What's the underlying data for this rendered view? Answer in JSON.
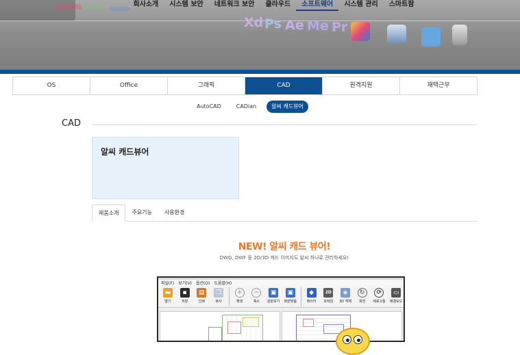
{
  "top_nav": [
    "회사소개",
    "시스템 보안",
    "네트워크 보안",
    "클라우드",
    "소프트웨어",
    "시스템 관리",
    "스마트팜"
  ],
  "top_nav_active": "소프트웨어",
  "hero_apps": [
    "Xd",
    "Ps",
    "Ae",
    "Me",
    "Pr"
  ],
  "category_tabs": [
    "OS",
    "Office",
    "그래픽",
    "CAD",
    "원격지원",
    "재택근무"
  ],
  "category_active": "CAD",
  "sub_tabs": [
    "AutoCAD",
    "CADian",
    "알씨 캐드뷰어"
  ],
  "sub_active": "알씨 캐드뷰어",
  "section_title": "CAD",
  "product_name": "알씨 캐드뷰어",
  "detail_tabs": [
    "제품소개",
    "주요기능",
    "사용환경"
  ],
  "detail_active": "제품소개",
  "promo": {
    "headline": "NEW! 알씨 캐드 뷰어!",
    "subtitle": "DWG, DWF 등 2D/3D 캐드 이미지도 알씨 하나로 관리하세요!"
  },
  "viewer": {
    "menu": [
      "파일(F)",
      "보기(V)",
      "옵션(O)",
      "도움말(H)"
    ],
    "tools": [
      {
        "label": "열기",
        "icon": "folder-icon",
        "color": "#e8a22a"
      },
      {
        "label": "저장",
        "icon": "save-icon",
        "color": "#2c2c2c"
      },
      {
        "label": "인쇄",
        "icon": "print-icon",
        "color": "#d07a2a"
      },
      {
        "label": "복사",
        "icon": "copy-icon",
        "color": "#b8c6d6"
      },
      {
        "label": "확대",
        "icon": "zoom-in-icon",
        "color": "#9a9a9a"
      },
      {
        "label": "축소",
        "icon": "zoom-out-icon",
        "color": "#9a9a9a"
      },
      {
        "label": "원본보기",
        "icon": "original-view-icon",
        "color": "#3a6fc0"
      },
      {
        "label": "화면맞춤",
        "icon": "fit-screen-icon",
        "color": "#3a6fc0"
      },
      {
        "label": "레이어",
        "icon": "layer-icon",
        "color": "#2f63b8"
      },
      {
        "label": "프레임",
        "icon": "frame-2d-icon",
        "color": "#5a5a5a"
      },
      {
        "label": "3D 객체",
        "icon": "3d-object-icon",
        "color": "#7b9ccf"
      },
      {
        "label": "회전",
        "icon": "rotate-icon",
        "color": "#666666"
      },
      {
        "label": "새로고침",
        "icon": "refresh-icon",
        "color": "#444444"
      },
      {
        "label": "배경모드",
        "icon": "background-mode-icon",
        "color": "#555555"
      }
    ]
  },
  "colors": {
    "accent": "#0d4f8f",
    "promo": "#e8792a",
    "info_box": "#e8f2fb"
  }
}
